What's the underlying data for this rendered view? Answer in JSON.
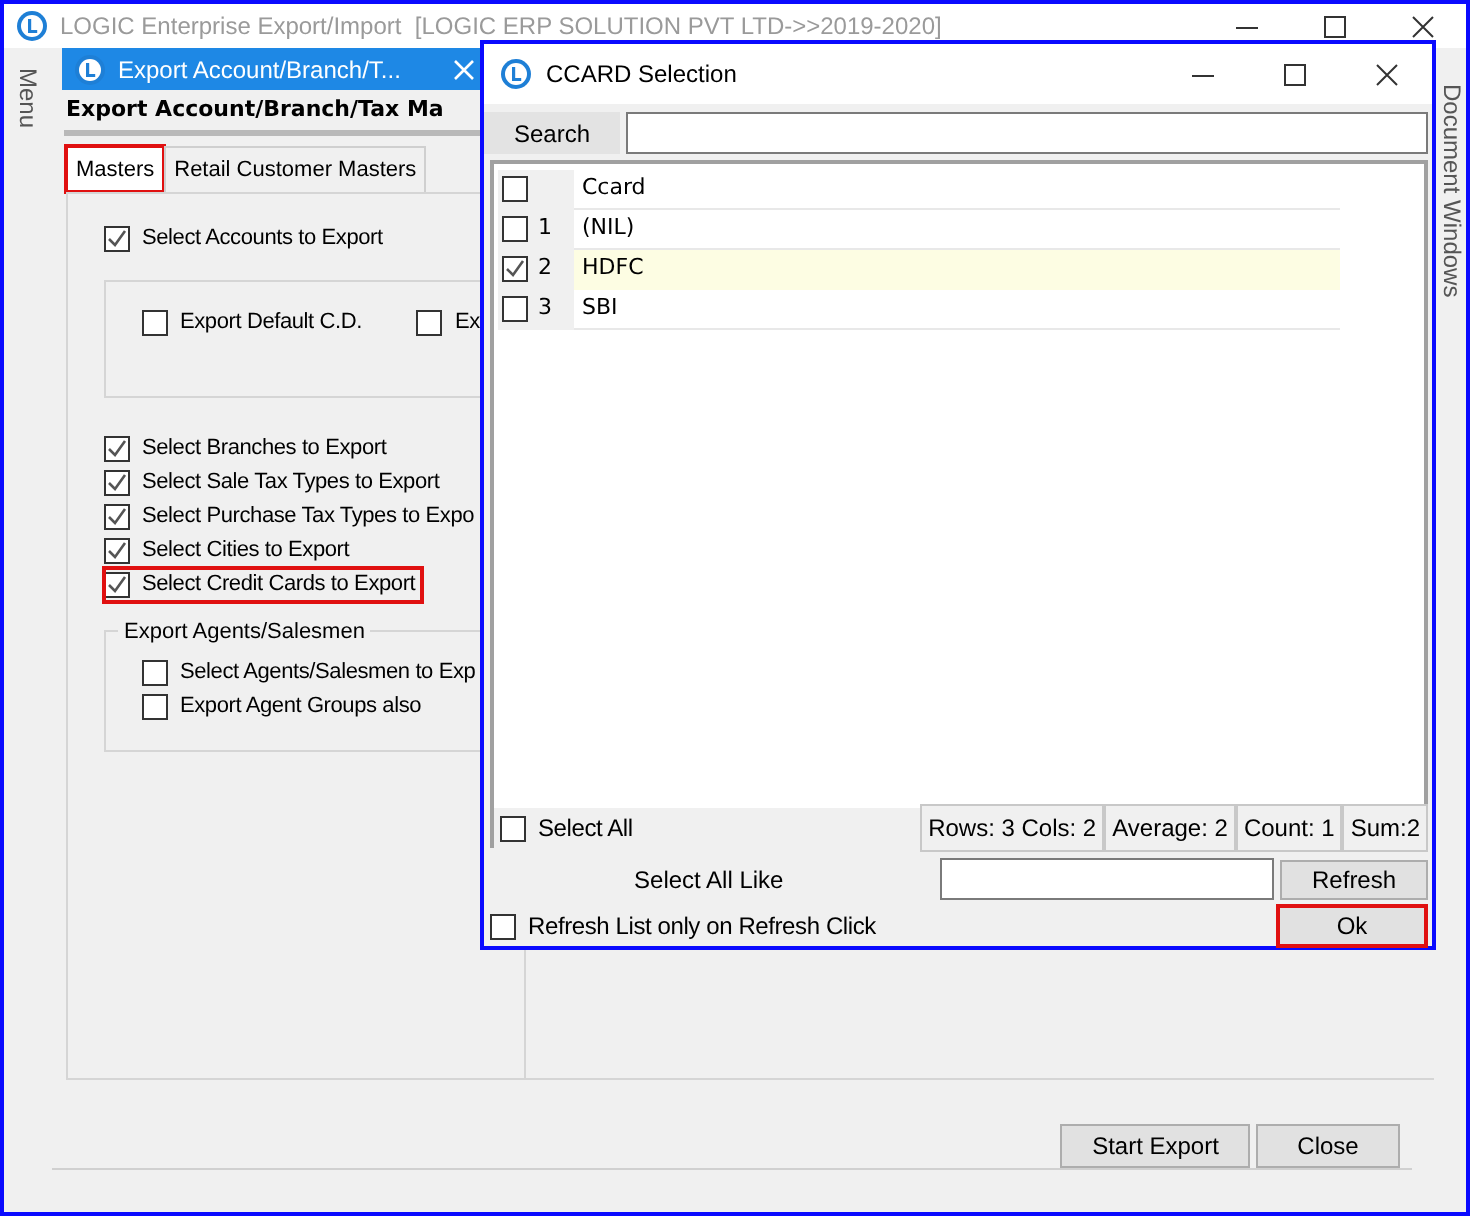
{
  "window": {
    "title": "LOGIC Enterprise Export/Import  [LOGIC ERP SOLUTION PVT LTD->>2019-2020]"
  },
  "side_panels": {
    "left": "Menu",
    "right": "Document Windows"
  },
  "document_tab": {
    "label": "Export Account/Branch/T...",
    "selected": true
  },
  "heading": "Export Account/Branch/Tax Ma",
  "tabs": [
    {
      "label": "Masters",
      "selected": true,
      "highlighted": true
    },
    {
      "label": "Retail Customer Masters",
      "selected": false,
      "highlighted": false
    }
  ],
  "accounts_option": {
    "label": "Select Accounts to Export",
    "checked": true
  },
  "accounts_group": [
    {
      "label": "Export Default C.D.",
      "checked": false
    },
    {
      "label": "Ex",
      "checked": false
    }
  ],
  "options": [
    {
      "label": "Select Branches to Export",
      "checked": true,
      "highlighted": false
    },
    {
      "label": "Select Sale Tax Types to Export",
      "checked": true,
      "highlighted": false
    },
    {
      "label": "Select Purchase Tax Types to Expo",
      "checked": true,
      "highlighted": false
    },
    {
      "label": "Select Cities to Export",
      "checked": true,
      "highlighted": false
    },
    {
      "label": "Select Credit Cards to Export",
      "checked": true,
      "highlighted": true
    }
  ],
  "agents_group": {
    "title": "Export Agents/Salesmen",
    "items": [
      {
        "label": "Select Agents/Salesmen to Exp",
        "checked": false
      },
      {
        "label": "Export Agent Groups also",
        "checked": false
      }
    ]
  },
  "buttons": [
    {
      "label": "Start Export"
    },
    {
      "label": "Close"
    }
  ],
  "dialog": {
    "title": "CCARD Selection",
    "search_button": "Search",
    "grid": {
      "header": {
        "label": "Ccard",
        "checked": false
      },
      "rows": [
        {
          "number": "1",
          "value": "(NIL)",
          "checked": false,
          "selected": false
        },
        {
          "number": "2",
          "value": "HDFC",
          "checked": true,
          "selected": true
        },
        {
          "number": "3",
          "value": "SBI",
          "checked": false,
          "selected": false
        }
      ]
    },
    "select_all": {
      "label": "Select All",
      "checked": false
    },
    "stats": [
      "Rows: 3  Cols: 2",
      "Average: 2",
      "Count: 1",
      "Sum:2"
    ],
    "select_all_like": "Select All Like",
    "refresh_button": "Refresh",
    "refresh_option": {
      "label": "Refresh List only on Refresh Click",
      "checked": false
    },
    "ok_button": {
      "label": "Ok",
      "highlighted": true
    }
  }
}
